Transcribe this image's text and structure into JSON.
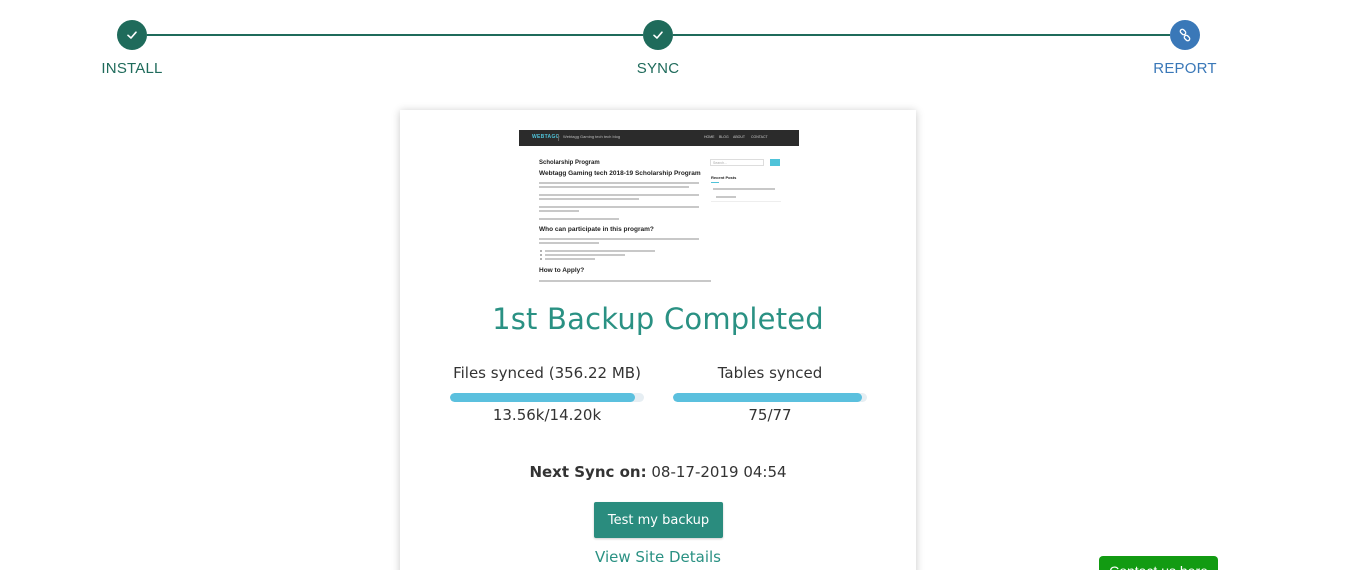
{
  "stepper": {
    "steps": [
      {
        "label": "INSTALL",
        "state": "done"
      },
      {
        "label": "SYNC",
        "state": "done"
      },
      {
        "label": "REPORT",
        "state": "current"
      }
    ],
    "colors": {
      "done": "#1f6b5b",
      "current": "#3a78b8"
    }
  },
  "preview": {
    "brand": "WEBTAGG",
    "tagline": "Webtagg Gaming tech tech blog",
    "menu": [
      "HOME",
      "BLOG",
      "ABOUT",
      "CONTACT"
    ],
    "page_heading": "Scholarship Program",
    "post_title": "Webtagg Gaming tech 2018-19 Scholarship Program",
    "section_1": "Who can participate in this program?",
    "section_2": "How to Apply?",
    "sidebar_search_placeholder": "Search...",
    "sidebar_heading": "Recent Posts"
  },
  "main": {
    "title": "1st Backup Completed",
    "files": {
      "label": "Files synced (356.22 MB)",
      "value": "13.56k/14.20k",
      "progress": 0.955
    },
    "tables": {
      "label": "Tables synced",
      "value": "75/77",
      "progress": 0.974
    },
    "next_sync_label": "Next Sync on:",
    "next_sync_value": "08-17-2019 04:54",
    "test_button": "Test my backup",
    "details_link": "View Site Details"
  },
  "contact": {
    "label": "Contact us here"
  },
  "colors": {
    "accent": "#2a9183",
    "progress": "#5bc0de",
    "contact": "#129b12"
  }
}
